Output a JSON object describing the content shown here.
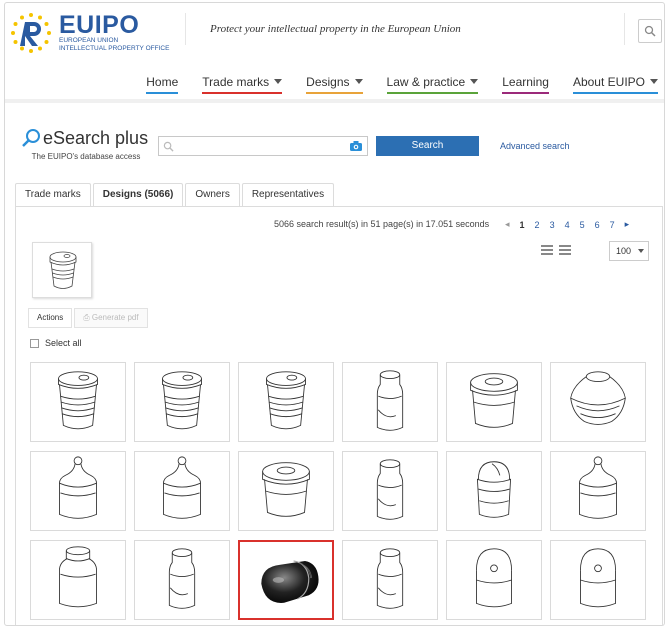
{
  "brand": {
    "name": "EUIPO",
    "sub1": "EUROPEAN UNION",
    "sub2": "INTELLECTUAL PROPERTY OFFICE",
    "tagline": "Protect your intellectual property in the European Union",
    "accent": "#2a5aa0",
    "star_color": "#f5c400"
  },
  "nav": {
    "items": [
      {
        "label": "Home",
        "color": "#2a8fd8",
        "dropdown": false
      },
      {
        "label": "Trade marks",
        "color": "#d9312c",
        "dropdown": true
      },
      {
        "label": "Designs",
        "color": "#e8a33a",
        "dropdown": true
      },
      {
        "label": "Law & practice",
        "color": "#5aa33a",
        "dropdown": true
      },
      {
        "label": "Learning",
        "color": "#9b2a7a",
        "dropdown": false
      },
      {
        "label": "About EUIPO",
        "color": "#2a8fd8",
        "dropdown": true
      }
    ]
  },
  "esearch": {
    "title": "eSearch plus",
    "subtitle": "The EUIPO's database access",
    "search_value": "",
    "search_button": "Search",
    "advanced": "Advanced search"
  },
  "tabs": [
    "Trade marks",
    "Designs (5066)",
    "Owners",
    "Representatives"
  ],
  "results": {
    "info": "5066 search result(s) in 51 page(s) in 17.051 seconds",
    "pages": [
      "1",
      "2",
      "3",
      "4",
      "5",
      "6",
      "7"
    ],
    "current_page": "1",
    "per_page": "100"
  },
  "actions": {
    "actions_label": "Actions",
    "generate_label": "Generate pdf",
    "select_all": "Select all"
  },
  "grid": {
    "items": [
      {
        "shape": "cup-lid"
      },
      {
        "shape": "cup-lid"
      },
      {
        "shape": "cup-lid"
      },
      {
        "shape": "slim-bottle"
      },
      {
        "shape": "jar-lid"
      },
      {
        "shape": "bowl"
      },
      {
        "shape": "baby-bottle"
      },
      {
        "shape": "baby-bottle"
      },
      {
        "shape": "jar-lid"
      },
      {
        "shape": "slim-bottle"
      },
      {
        "shape": "dome-cup"
      },
      {
        "shape": "baby-bottle"
      },
      {
        "shape": "tall-jar"
      },
      {
        "shape": "slim-bottle"
      },
      {
        "shape": "dark-cap",
        "selected": true
      },
      {
        "shape": "slim-bottle"
      },
      {
        "shape": "dome-jar"
      },
      {
        "shape": "dome-jar"
      }
    ]
  }
}
